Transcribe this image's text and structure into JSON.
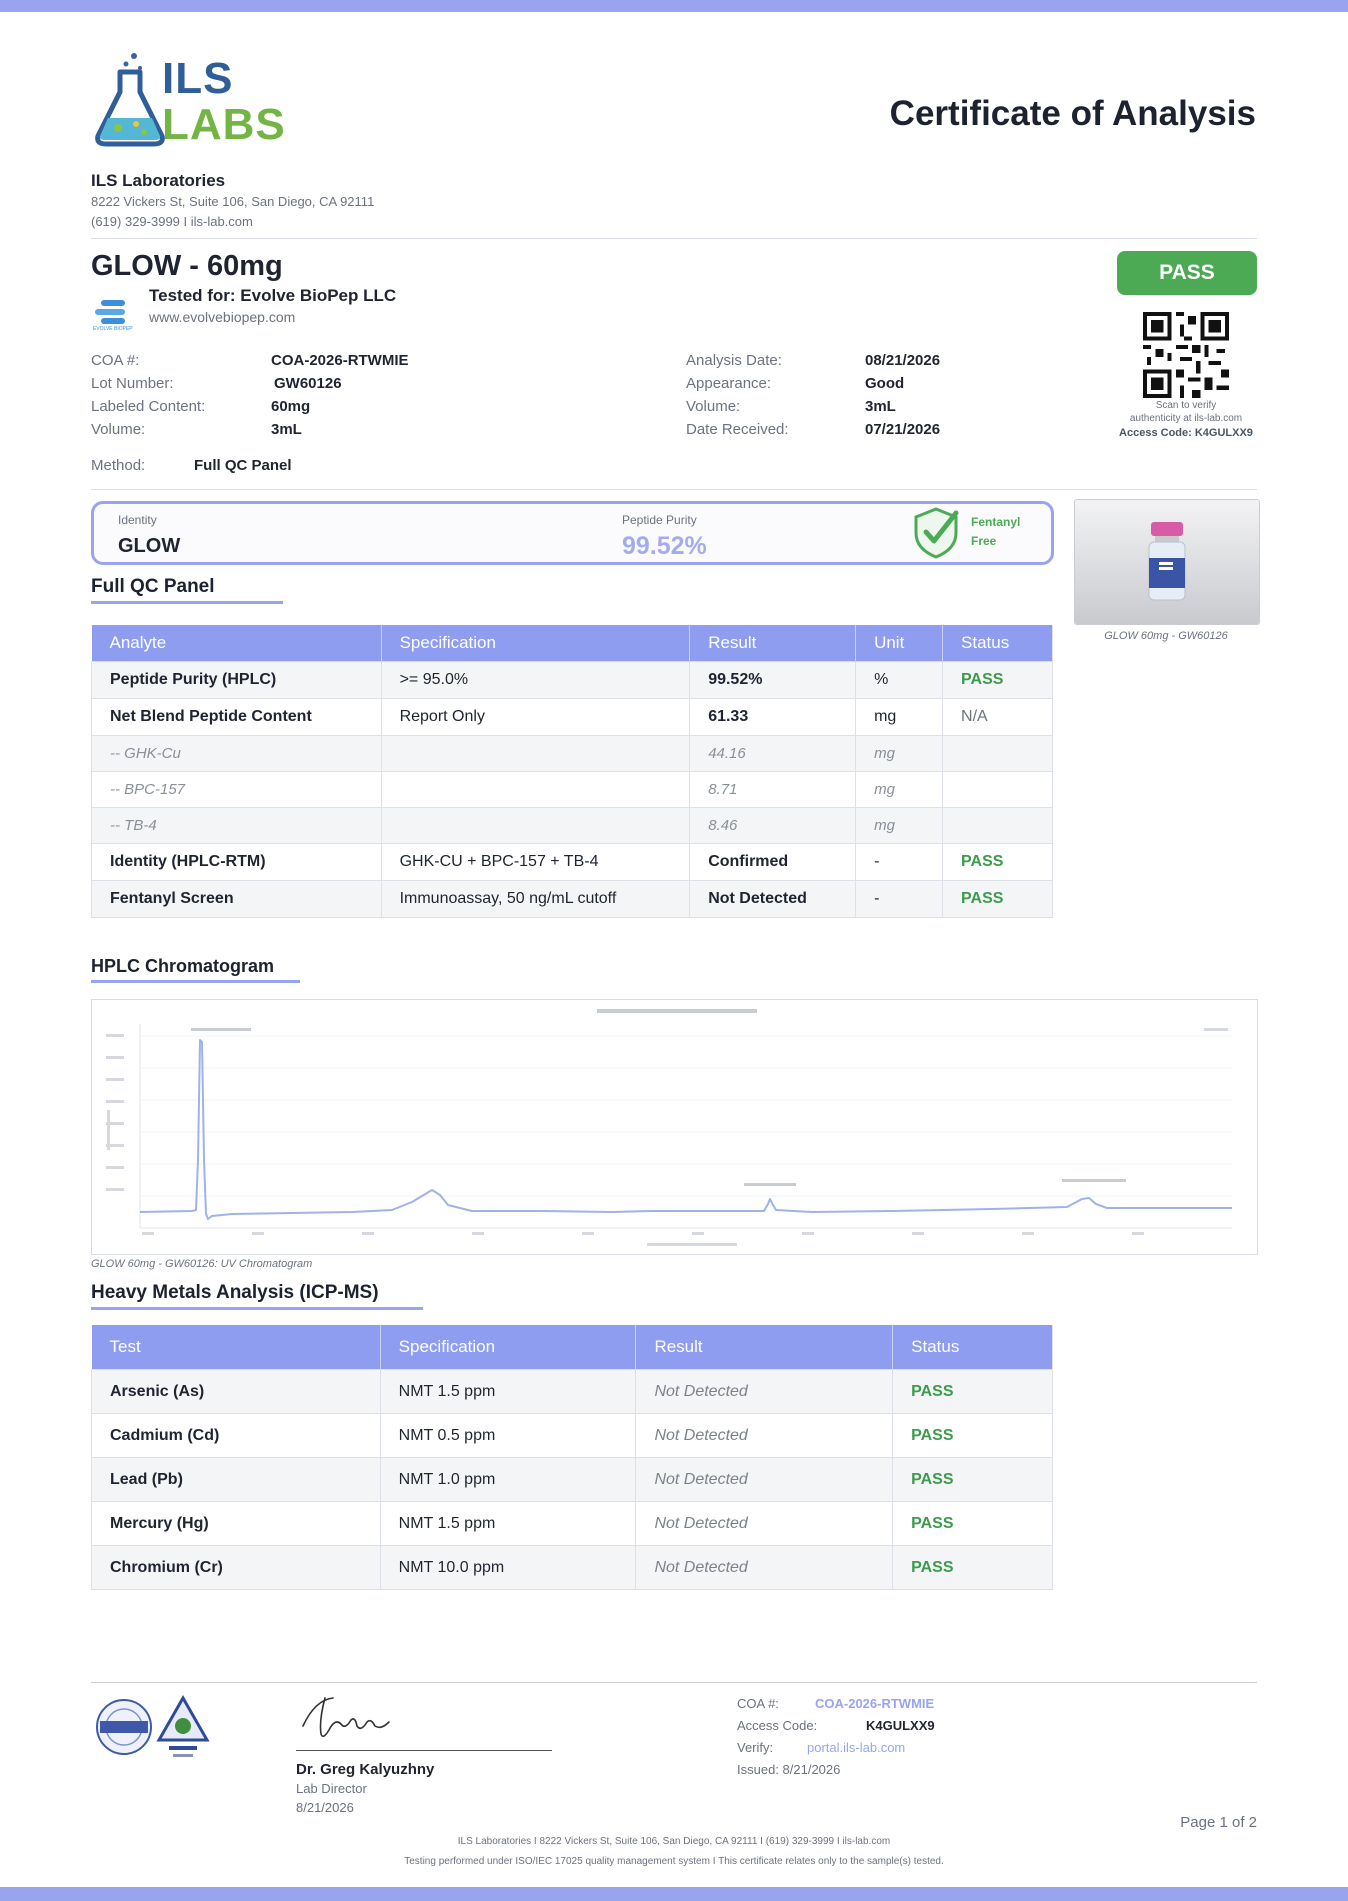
{
  "header": {
    "logo_top": "ILS",
    "logo_bottom": "LABS",
    "doc_title": "Certificate of Analysis",
    "lab_name": "ILS Laboratories",
    "lab_address": "8222 Vickers St, Suite 106, San Diego, CA 92111",
    "lab_contact": "(619) 329-3999  I  ils-lab.com"
  },
  "product": {
    "name": "GLOW - 60mg",
    "tested_for": "Tested for: Evolve BioPep LLC",
    "client_url": "www.evolvebiopep.com",
    "client_logo_text": "EVOLVE BIOPEP",
    "status_badge": "PASS"
  },
  "details_left": [
    {
      "label": "COA #:",
      "value": "COA-2026-RTWMIE"
    },
    {
      "label": "Lot Number:",
      "value": "GW60126"
    },
    {
      "label": "Labeled Content:",
      "value": "60mg"
    },
    {
      "label": "Volume:",
      "value": "3mL"
    }
  ],
  "details_right": [
    {
      "label": "Analysis Date:",
      "value": "08/21/2026"
    },
    {
      "label": "Appearance:",
      "value": "Good"
    },
    {
      "label": "Volume:",
      "value": "3mL"
    },
    {
      "label": "Date Received:",
      "value": "07/21/2026"
    }
  ],
  "method": {
    "label": "Method:",
    "value": "Full QC Panel"
  },
  "verify": {
    "scan_line1": "Scan to verify",
    "scan_line2": "authenticity at ils-lab.com",
    "access_code": "Access Code: K4GULXX9"
  },
  "summary": {
    "identity_label": "Identity",
    "identity_value": "GLOW",
    "purity_label": "Peptide Purity",
    "purity_value": "99.52%",
    "fentanyl_line1": "Fentanyl",
    "fentanyl_line2": "Free"
  },
  "photo": {
    "caption": "GLOW 60mg -  GW60126"
  },
  "qc_panel": {
    "title": "Full QC Panel",
    "headers": [
      "Analyte",
      "Specification",
      "Result",
      "Unit",
      "Status"
    ],
    "rows": [
      {
        "analyte": "Peptide Purity (HPLC)",
        "spec": ">= 95.0%",
        "result": "99.52%",
        "unit": "%",
        "status": "PASS"
      },
      {
        "analyte": "Net Blend Peptide Content",
        "spec": "Report Only",
        "result": "61.33",
        "unit": "mg",
        "status": "N/A"
      },
      {
        "analyte": "-- GHK-Cu",
        "spec": "",
        "result": "44.16",
        "unit": "mg",
        "status": ""
      },
      {
        "analyte": "-- BPC-157",
        "spec": "",
        "result": "8.71",
        "unit": "mg",
        "status": ""
      },
      {
        "analyte": "-- TB-4",
        "spec": "",
        "result": "8.46",
        "unit": "mg",
        "status": ""
      },
      {
        "analyte": "Identity (HPLC-RTM)",
        "spec": "GHK-CU + BPC-157 + TB-4",
        "result": "Confirmed",
        "unit": "-",
        "status": "PASS"
      },
      {
        "analyte": "Fentanyl Screen",
        "spec": "Immunoassay, 50 ng/mL cutoff",
        "result": "Not Detected",
        "unit": "-",
        "status": "PASS"
      }
    ]
  },
  "chromatogram": {
    "title": "HPLC Chromatogram",
    "caption": "GLOW 60mg -  GW60126: UV Chromatogram",
    "line_color": "#9fb2ea"
  },
  "heavy_metals": {
    "title": "Heavy Metals Analysis (ICP-MS)",
    "headers": [
      "Test",
      "Specification",
      "Result",
      "Status"
    ],
    "rows": [
      {
        "test": "Arsenic (As)",
        "spec": "NMT 1.5 ppm",
        "result": "Not Detected",
        "status": "PASS"
      },
      {
        "test": "Cadmium (Cd)",
        "spec": "NMT 0.5 ppm",
        "result": "Not Detected",
        "status": "PASS"
      },
      {
        "test": "Lead (Pb)",
        "spec": "NMT 1.0 ppm",
        "result": "Not Detected",
        "status": "PASS"
      },
      {
        "test": "Mercury (Hg)",
        "spec": "NMT 1.5 ppm",
        "result": "Not Detected",
        "status": "PASS"
      },
      {
        "test": "Chromium (Cr)",
        "spec": "NMT 10.0 ppm",
        "result": "Not Detected",
        "status": "PASS"
      }
    ]
  },
  "footer": {
    "signer_name": "Dr. Greg Kalyuzhny",
    "signer_title": "Lab Director",
    "sign_date": "8/21/2026",
    "coa_label": "COA #:",
    "coa_value": "COA-2026-RTWMIE",
    "access_label": "Access Code:",
    "access_value": "K4GULXX9",
    "verify_label": "Verify:",
    "verify_value": "portal.ils-lab.com",
    "issued": "Issued: 8/21/2026",
    "page": "Page 1 of 2",
    "line1": "ILS Laboratories  I  8222 Vickers St, Suite 106, San Diego, CA 92111  I  (619) 329-3999  I  ils-lab.com",
    "line2": "Testing performed under ISO/IEC 17025 quality management system  I  This certificate relates only to the sample(s) tested."
  },
  "colors": {
    "accent": "#98a4ef",
    "pass_green": "#4caa55",
    "title_dark": "#1c2230"
  }
}
